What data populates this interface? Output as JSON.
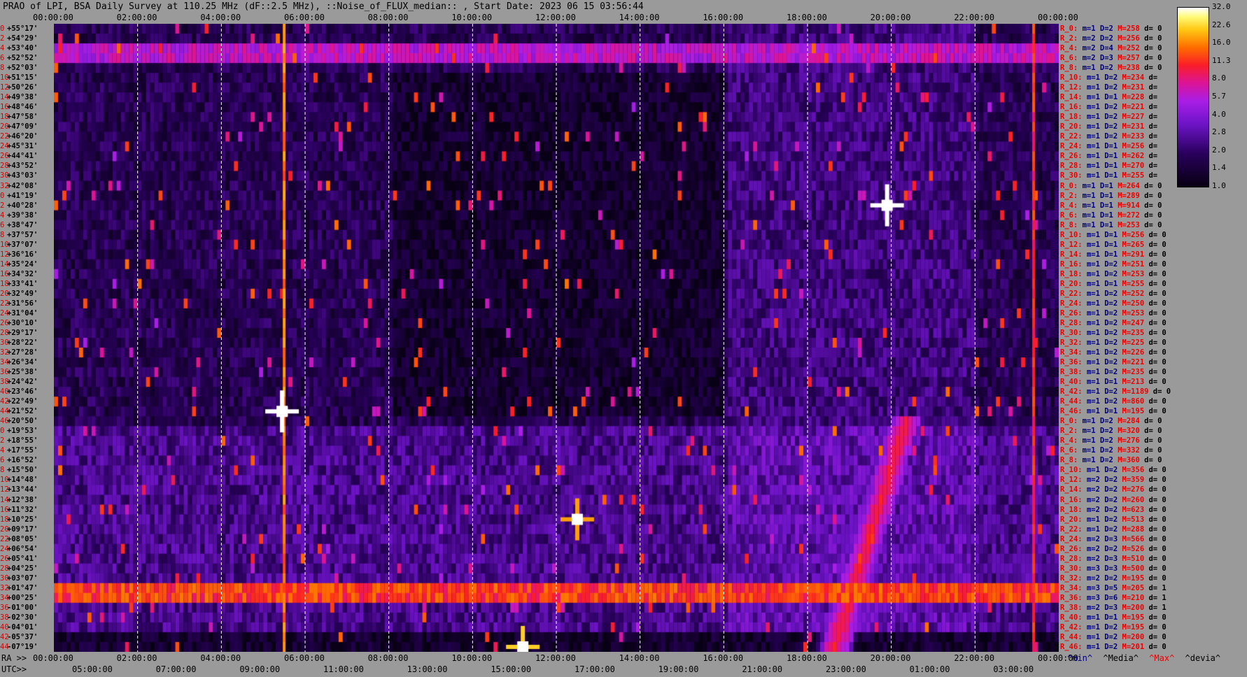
{
  "title": "PRAO of LPI, BSA Daily Survey at 110.25 MHz (dF::2.5 MHz), ::Noise_of_FLUX_median:: , Start Date: 2023 06 15 03:56:44",
  "axes": {
    "top_ticks": [
      "00:00:00",
      "02:00:00",
      "04:00:00",
      "06:00:00",
      "08:00:00",
      "10:00:00",
      "12:00:00",
      "14:00:00",
      "16:00:00",
      "18:00:00",
      "20:00:00",
      "22:00:00",
      "00:00:00"
    ],
    "ra_prefix": "RA >>",
    "ra_ticks": [
      "00:00:00",
      "02:00:00",
      "04:00:00",
      "06:00:00",
      "08:00:00",
      "10:00:00",
      "12:00:00",
      "14:00:00",
      "16:00:00",
      "18:00:00",
      "20:00:00",
      "22:00:00",
      "00:00:00"
    ],
    "utc_prefix": "UTC>>",
    "utc_ticks": [
      "05:00:00",
      "07:00:00",
      "09:00:00",
      "11:00:00",
      "13:00:00",
      "15:00:00",
      "17:00:00",
      "19:00:00",
      "21:00:00",
      "23:00:00",
      "01:00:00",
      "03:00:00"
    ]
  },
  "declinations": [
    {
      "i": "0",
      "v": "+55°17'"
    },
    {
      "i": "2",
      "v": "+54°29'"
    },
    {
      "i": "4",
      "v": "+53°40'"
    },
    {
      "i": "6",
      "v": "+52°52'"
    },
    {
      "i": "8",
      "v": "+52°03'"
    },
    {
      "i": "10",
      "v": "+51°15'"
    },
    {
      "i": "12",
      "v": "+50°26'"
    },
    {
      "i": "14",
      "v": "+49°38'"
    },
    {
      "i": "16",
      "v": "+48°46'"
    },
    {
      "i": "18",
      "v": "+47°58'"
    },
    {
      "i": "20",
      "v": "+47°09'"
    },
    {
      "i": "22",
      "v": "+46°20'"
    },
    {
      "i": "24",
      "v": "+45°31'"
    },
    {
      "i": "26",
      "v": "+44°41'"
    },
    {
      "i": "28",
      "v": "+43°52'"
    },
    {
      "i": "30",
      "v": "+43°03'"
    },
    {
      "i": "32",
      "v": "+42°08'"
    },
    {
      "i": "0",
      "v": "+41°19'"
    },
    {
      "i": "2",
      "v": "+40°28'"
    },
    {
      "i": "4",
      "v": "+39°38'"
    },
    {
      "i": "6",
      "v": "+38°47'"
    },
    {
      "i": "8",
      "v": "+37°57'"
    },
    {
      "i": "10",
      "v": "+37°07'"
    },
    {
      "i": "12",
      "v": "+36°16'"
    },
    {
      "i": "14",
      "v": "+35°24'"
    },
    {
      "i": "16",
      "v": "+34°32'"
    },
    {
      "i": "18",
      "v": "+33°41'"
    },
    {
      "i": "20",
      "v": "+32°49'"
    },
    {
      "i": "22",
      "v": "+31°56'"
    },
    {
      "i": "24",
      "v": "+31°04'"
    },
    {
      "i": "26",
      "v": "+30°10'"
    },
    {
      "i": "28",
      "v": "+29°17'"
    },
    {
      "i": "30",
      "v": "+28°22'"
    },
    {
      "i": "32",
      "v": "+27°28'"
    },
    {
      "i": "34",
      "v": "+26°34'"
    },
    {
      "i": "36",
      "v": "+25°38'"
    },
    {
      "i": "38",
      "v": "+24°42'"
    },
    {
      "i": "40",
      "v": "+23°46'"
    },
    {
      "i": "42",
      "v": "+22°49'"
    },
    {
      "i": "44",
      "v": "+21°52'"
    },
    {
      "i": "46",
      "v": "+20°50'"
    },
    {
      "i": "0",
      "v": "+19°53'"
    },
    {
      "i": "2",
      "v": "+18°55'"
    },
    {
      "i": "4",
      "v": "+17°55'"
    },
    {
      "i": "6",
      "v": "+16°52'"
    },
    {
      "i": "8",
      "v": "+15°50'"
    },
    {
      "i": "10",
      "v": "+14°48'"
    },
    {
      "i": "12",
      "v": "+13°44'"
    },
    {
      "i": "14",
      "v": "+12°38'"
    },
    {
      "i": "16",
      "v": "+11°32'"
    },
    {
      "i": "18",
      "v": "+10°25'"
    },
    {
      "i": "20",
      "v": "+09°17'"
    },
    {
      "i": "22",
      "v": "+08°05'"
    },
    {
      "i": "24",
      "v": "+06°54'"
    },
    {
      "i": "26",
      "v": "+05°41'"
    },
    {
      "i": "28",
      "v": "+04°25'"
    },
    {
      "i": "30",
      "v": "+03°07'"
    },
    {
      "i": "32",
      "v": "+01°47'"
    },
    {
      "i": "34",
      "v": "+00°25'"
    },
    {
      "i": "36",
      "v": "-01°00'"
    },
    {
      "i": "38",
      "v": "-02°30'"
    },
    {
      "i": "40",
      "v": "-04°01'"
    },
    {
      "i": "42",
      "v": "-05°37'"
    },
    {
      "i": "44",
      "v": "-07°19'"
    }
  ],
  "stats": [
    {
      "r": "R_0:",
      "m": "m=1",
      "d": "D=2",
      "M": "M=258",
      "dev": "d= 0"
    },
    {
      "r": "R_2:",
      "m": "m=2",
      "d": "D=2",
      "M": "M=256",
      "dev": "d= 0"
    },
    {
      "r": "R_4:",
      "m": "m=2",
      "d": "D=4",
      "M": "M=252",
      "dev": "d= 0"
    },
    {
      "r": "R_6:",
      "m": "m=2",
      "d": "D=3",
      "M": "M=257",
      "dev": "d= 0"
    },
    {
      "r": "R_8:",
      "m": "m=1",
      "d": "D=2",
      "M": "M=238",
      "dev": "d= 0"
    },
    {
      "r": "R_10:",
      "m": "m=1",
      "d": "D=2",
      "M": "M=234",
      "dev": "d="
    },
    {
      "r": "R_12:",
      "m": "m=1",
      "d": "D=2",
      "M": "M=231",
      "dev": "d="
    },
    {
      "r": "R_14:",
      "m": "m=1",
      "d": "D=1",
      "M": "M=228",
      "dev": "d="
    },
    {
      "r": "R_16:",
      "m": "m=1",
      "d": "D=2",
      "M": "M=221",
      "dev": "d="
    },
    {
      "r": "R_18:",
      "m": "m=1",
      "d": "D=2",
      "M": "M=227",
      "dev": "d="
    },
    {
      "r": "R_20:",
      "m": "m=1",
      "d": "D=2",
      "M": "M=231",
      "dev": "d="
    },
    {
      "r": "R_22:",
      "m": "m=1",
      "d": "D=2",
      "M": "M=233",
      "dev": "d="
    },
    {
      "r": "R_24:",
      "m": "m=1",
      "d": "D=1",
      "M": "M=256",
      "dev": "d="
    },
    {
      "r": "R_26:",
      "m": "m=1",
      "d": "D=1",
      "M": "M=262",
      "dev": "d="
    },
    {
      "r": "R_28:",
      "m": "m=1",
      "d": "D=1",
      "M": "M=270",
      "dev": "d="
    },
    {
      "r": "R_30:",
      "m": "m=1",
      "d": "D=1",
      "M": "M=255",
      "dev": "d="
    },
    {
      "r": "R_0:",
      "m": "m=1",
      "d": "D=1",
      "M": "M=264",
      "dev": "d= 0"
    },
    {
      "r": "R_2:",
      "m": "m=1",
      "d": "D=1",
      "M": "M=289",
      "dev": "d= 0"
    },
    {
      "r": "R_4:",
      "m": "m=1",
      "d": "D=1",
      "M": "M=914",
      "dev": "d= 0"
    },
    {
      "r": "R_6:",
      "m": "m=1",
      "d": "D=1",
      "M": "M=272",
      "dev": "d= 0"
    },
    {
      "r": "R_8:",
      "m": "m=1",
      "d": "D=1",
      "M": "M=253",
      "dev": "d= 0"
    },
    {
      "r": "R_10:",
      "m": "m=1",
      "d": "D=1",
      "M": "M=256",
      "dev": "d= 0"
    },
    {
      "r": "R_12:",
      "m": "m=1",
      "d": "D=1",
      "M": "M=265",
      "dev": "d= 0"
    },
    {
      "r": "R_14:",
      "m": "m=1",
      "d": "D=1",
      "M": "M=291",
      "dev": "d= 0"
    },
    {
      "r": "R_16:",
      "m": "m=1",
      "d": "D=2",
      "M": "M=251",
      "dev": "d= 0"
    },
    {
      "r": "R_18:",
      "m": "m=1",
      "d": "D=2",
      "M": "M=253",
      "dev": "d= 0"
    },
    {
      "r": "R_20:",
      "m": "m=1",
      "d": "D=1",
      "M": "M=255",
      "dev": "d= 0"
    },
    {
      "r": "R_22:",
      "m": "m=1",
      "d": "D=2",
      "M": "M=252",
      "dev": "d= 0"
    },
    {
      "r": "R_24:",
      "m": "m=1",
      "d": "D=2",
      "M": "M=250",
      "dev": "d= 0"
    },
    {
      "r": "R_26:",
      "m": "m=1",
      "d": "D=2",
      "M": "M=253",
      "dev": "d= 0"
    },
    {
      "r": "R_28:",
      "m": "m=1",
      "d": "D=2",
      "M": "M=247",
      "dev": "d= 0"
    },
    {
      "r": "R_30:",
      "m": "m=1",
      "d": "D=2",
      "M": "M=235",
      "dev": "d= 0"
    },
    {
      "r": "R_32:",
      "m": "m=1",
      "d": "D=2",
      "M": "M=225",
      "dev": "d= 0"
    },
    {
      "r": "R_34:",
      "m": "m=1",
      "d": "D=2",
      "M": "M=226",
      "dev": "d= 0"
    },
    {
      "r": "R_36:",
      "m": "m=1",
      "d": "D=2",
      "M": "M=221",
      "dev": "d= 0"
    },
    {
      "r": "R_38:",
      "m": "m=1",
      "d": "D=2",
      "M": "M=235",
      "dev": "d= 0"
    },
    {
      "r": "R_40:",
      "m": "m=1",
      "d": "D=1",
      "M": "M=213",
      "dev": "d= 0"
    },
    {
      "r": "R_42:",
      "m": "m=1",
      "d": "D=2",
      "M": "M=1189",
      "dev": "d= 0"
    },
    {
      "r": "R_44:",
      "m": "m=1",
      "d": "D=2",
      "M": "M=860",
      "dev": "d= 0"
    },
    {
      "r": "R_46:",
      "m": "m=1",
      "d": "D=1",
      "M": "M=195",
      "dev": "d= 0"
    },
    {
      "r": "R_0:",
      "m": "m=1",
      "d": "D=2",
      "M": "M=284",
      "dev": "d= 0"
    },
    {
      "r": "R_2:",
      "m": "m=1",
      "d": "D=2",
      "M": "M=320",
      "dev": "d= 0"
    },
    {
      "r": "R_4:",
      "m": "m=1",
      "d": "D=2",
      "M": "M=276",
      "dev": "d= 0"
    },
    {
      "r": "R_6:",
      "m": "m=1",
      "d": "D=2",
      "M": "M=332",
      "dev": "d= 0"
    },
    {
      "r": "R_8:",
      "m": "m=1",
      "d": "D=2",
      "M": "M=360",
      "dev": "d= 0"
    },
    {
      "r": "R_10:",
      "m": "m=1",
      "d": "D=2",
      "M": "M=356",
      "dev": "d= 0"
    },
    {
      "r": "R_12:",
      "m": "m=2",
      "d": "D=2",
      "M": "M=359",
      "dev": "d= 0"
    },
    {
      "r": "R_14:",
      "m": "m=2",
      "d": "D=2",
      "M": "M=276",
      "dev": "d= 0"
    },
    {
      "r": "R_16:",
      "m": "m=2",
      "d": "D=2",
      "M": "M=260",
      "dev": "d= 0"
    },
    {
      "r": "R_18:",
      "m": "m=2",
      "d": "D=2",
      "M": "M=623",
      "dev": "d= 0"
    },
    {
      "r": "R_20:",
      "m": "m=1",
      "d": "D=2",
      "M": "M=513",
      "dev": "d= 0"
    },
    {
      "r": "R_22:",
      "m": "m=1",
      "d": "D=2",
      "M": "M=288",
      "dev": "d= 0"
    },
    {
      "r": "R_24:",
      "m": "m=2",
      "d": "D=3",
      "M": "M=566",
      "dev": "d= 0"
    },
    {
      "r": "R_26:",
      "m": "m=2",
      "d": "D=2",
      "M": "M=526",
      "dev": "d= 0"
    },
    {
      "r": "R_28:",
      "m": "m=2",
      "d": "D=3",
      "M": "M=510",
      "dev": "d= 0"
    },
    {
      "r": "R_30:",
      "m": "m=3",
      "d": "D=3",
      "M": "M=500",
      "dev": "d= 0"
    },
    {
      "r": "R_32:",
      "m": "m=2",
      "d": "D=2",
      "M": "M=195",
      "dev": "d= 0"
    },
    {
      "r": "R_34:",
      "m": "m=3",
      "d": "D=5",
      "M": "M=205",
      "dev": "d= 1"
    },
    {
      "r": "R_36:",
      "m": "m=3",
      "d": "D=6",
      "M": "M=210",
      "dev": "d= 1"
    },
    {
      "r": "R_38:",
      "m": "m=2",
      "d": "D=3",
      "M": "M=200",
      "dev": "d= 1"
    },
    {
      "r": "R_40:",
      "m": "m=1",
      "d": "D=1",
      "M": "M=195",
      "dev": "d= 0"
    },
    {
      "r": "R_42:",
      "m": "m=1",
      "d": "D=2",
      "M": "M=195",
      "dev": "d= 0"
    },
    {
      "r": "R_44:",
      "m": "m=1",
      "d": "D=2",
      "M": "M=200",
      "dev": "d= 0"
    },
    {
      "r": "R_46:",
      "m": "m=1",
      "d": "D=2",
      "M": "M=201",
      "dev": "d= 0"
    }
  ],
  "legend": {
    "min": "^min^",
    "median": "^Media^",
    "max": "^Max^",
    "deviation": "^devia^"
  },
  "colorbar": {
    "ticks": [
      "32.0",
      "22.6",
      "16.0",
      "11.3",
      "8.0",
      "5.7",
      "4.0",
      "2.8",
      "2.0",
      "1.4",
      "1.0"
    ]
  },
  "colors": {
    "background": "#9a9a9a",
    "plot_dark": "#150022",
    "accent_red": "#e00000",
    "accent_navy": "#000080"
  },
  "chart_data": {
    "type": "heatmap",
    "title": "PRAO of LPI, BSA Daily Survey at 110.25 MHz (dF::2.5 MHz), ::Noise_of_FLUX_median:: , Start Date: 2023 06 15 03:56:44",
    "x_unit": "hours of RA",
    "xlim": [
      0,
      24
    ],
    "ylim": [
      -7.32,
      55.28
    ],
    "y_rows": 64,
    "colormap": "gnuplot-like (black → purple → red → orange → yellow → white)",
    "colorbar_range": [
      1.0,
      32.0
    ],
    "colorbar_scale": "log",
    "features": [
      {
        "type": "point_source",
        "x_hour": 5.45,
        "dec_index_row": 39,
        "intensity": 32
      },
      {
        "type": "point_source",
        "x_hour": 19.9,
        "dec_index_row": 18,
        "intensity": 32
      },
      {
        "type": "point_source",
        "x_hour": 12.5,
        "dec_index_row": 50,
        "intensity": 18
      },
      {
        "type": "point_source",
        "x_hour": 11.2,
        "dec_index_row": 63,
        "intensity": 22
      },
      {
        "type": "horizontal_band",
        "dec_row_from": 2,
        "dec_row_to": 3,
        "intensity": 6
      },
      {
        "type": "horizontal_band",
        "dec_row_from": 57,
        "dec_row_to": 58,
        "intensity": 12
      },
      {
        "type": "diagonal_track",
        "from": [
          18.6,
          63
        ],
        "to": [
          20.3,
          40
        ],
        "intensity": 9
      },
      {
        "type": "vertical_line",
        "x_hour": 5.5,
        "intensity": 20
      },
      {
        "type": "vertical_line",
        "x_hour": 23.4,
        "intensity": 14
      }
    ],
    "dashed_gridlines_hours": [
      2,
      4,
      6,
      8,
      10,
      12,
      14,
      16,
      18,
      20,
      22
    ]
  }
}
